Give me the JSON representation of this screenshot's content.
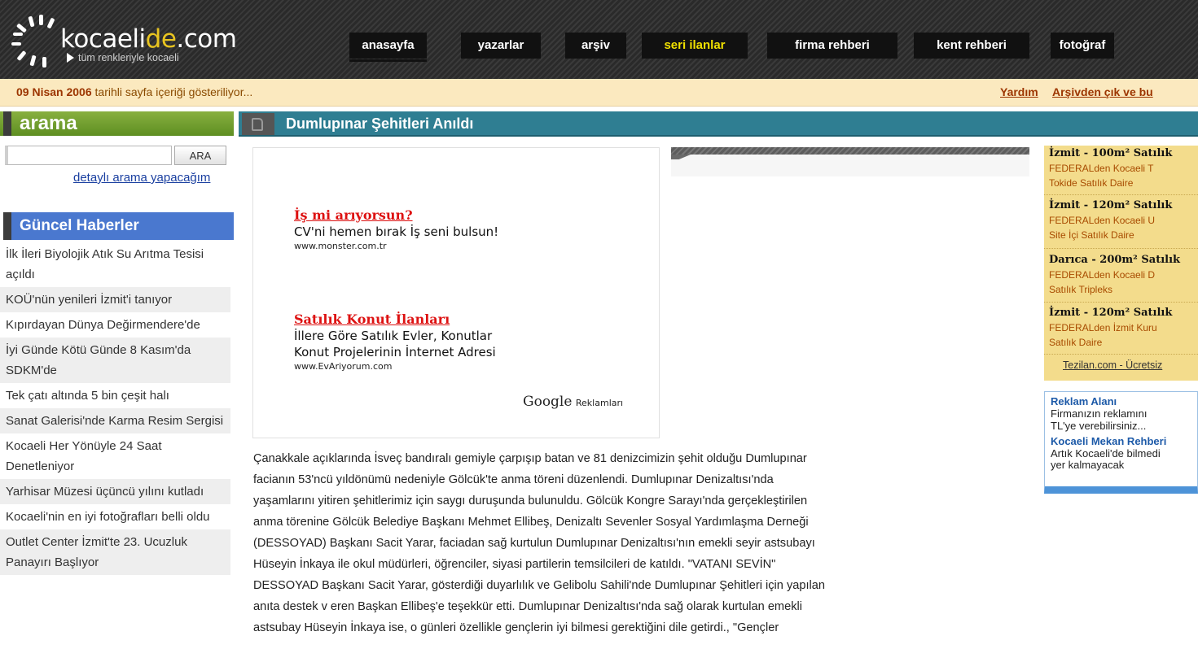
{
  "logo": {
    "brand_prefix": "kocaeli",
    "brand_accent": "de",
    "brand_suffix": ".com",
    "tagline": "tüm renkleriyle kocaeli"
  },
  "nav": {
    "items": [
      "anasayfa",
      "yazarlar",
      "arşiv",
      "seri ilanlar",
      "firma rehberi",
      "kent rehberi",
      "fotoğraf"
    ],
    "highlighted": "seri ilanlar"
  },
  "infobar": {
    "date": "09 Nisan 2006",
    "date_suffix": " tarihli sayfa içeriği gösteriliyor...",
    "help": "Yardım",
    "archive_exit": "Arşivden çık ve bu"
  },
  "sidebar": {
    "search_title": "arama",
    "search_input_value": "",
    "search_button": "ARA",
    "detailed_search": "detaylı arama yapacağım",
    "news_title": "Güncel Haberler",
    "news": [
      "İlk İleri Biyolojik Atık Su Arıtma Tesisi açıldı",
      "KOÜ'nün yenileri İzmit'i tanıyor",
      "Kıpırdayan Dünya Değirmendere'de",
      "İyi Günde Kötü Günde 8 Kasım'da SDKM'de",
      "Tek çatı altında 5 bin çeşit halı",
      "Sanat Galerisi'nde Karma Resim Sergisi",
      "Kocaeli Her Yönüyle 24 Saat Denetleniyor",
      "Yarhisar Müzesi üçüncü yılını kutladı",
      "Kocaeli'nin en iyi fotoğrafları belli oldu",
      "Outlet Center İzmit'te 23. Ucuzluk Panayırı Başlıyor"
    ]
  },
  "main": {
    "title": "Dumlupınar Şehitleri Anıldı",
    "ads": [
      {
        "title": "İş mi arıyorsun?",
        "lines": [
          "CV'ni hemen bırak İş seni bulsun!"
        ],
        "url": "www.monster.com.tr"
      },
      {
        "title": "Satılık Konut İlanları",
        "lines": [
          "İllere Göre Satılık Evler, Konutlar",
          "Konut Projelerinin İnternet Adresi"
        ],
        "url": "www.EvAriyorum.com"
      }
    ],
    "google_brand": "Google",
    "google_label": "Reklamları",
    "article_lines": [
      "Çanakkale açıklarında İsveç bandıralı gemiyle çarpışıp batan ve 81 denizcimizin şehit olduğu Dumlupınar",
      "facianın 53'ncü yıldönümü nedeniyle Gölcük'te anma töreni düzenlendi. Dumlupınar Denizaltısı'nda",
      "yaşamlarını yitiren şehitlerimiz için saygı duruşunda bulunuldu. Gölcük Kongre Sarayı'nda gerçekleştirilen",
      "anma törenine Gölcük Belediye Başkanı Mehmet Ellibeş, Denizaltı Sevenler Sosyal Yardımlaşma Derneği",
      "(DESSOYAD) Başkanı Sacit Yarar, faciadan sağ kurtulun Dumlupınar Denizaltısı'nın emekli seyir astsubayı",
      "Hüseyin İnkaya ile okul müdürleri, öğrenciler, siyasi partilerin temsilcileri de katıldı. \"VATANI SEVİN\"",
      "DESSOYAD Başkanı Sacit Yarar, gösterdiği duyarlılık ve Gelibolu Sahili'nde Dumlupınar Şehitleri için yapılan",
      "anıta destek v eren Başkan Ellibeş'e teşekkür etti. Dumlupınar Denizaltısı'nda sağ olarak kurtulan emekli",
      "astsubay Hüseyin İnkaya ise, o günleri özellikle gençlerin iyi bilmesi gerektiğini dile getirdi., \"Gençler"
    ]
  },
  "listings": {
    "items": [
      {
        "title": "İzmit - 100m² Satılık",
        "desc": [
          "FEDERALden Kocaeli T",
          "Tokide Satılık Daire"
        ]
      },
      {
        "title": "İzmit - 120m² Satılık",
        "desc": [
          "FEDERALden Kocaeli U",
          "Site İçi Satılık Daire"
        ]
      },
      {
        "title": "Darıca - 200m² Satılık",
        "desc": [
          "FEDERALden Kocaeli D",
          "Satılık Tripleks"
        ]
      },
      {
        "title": "İzmit - 120m² Satılık",
        "desc": [
          "FEDERALden İzmit Kuru",
          "Satılık Daire"
        ]
      }
    ],
    "footer_link": "Tezilan.com - Ücretsiz"
  },
  "ad_area": {
    "title": "Reklam Alanı",
    "text_lines": [
      "Firmanızın reklamını",
      "TL'ye verebilirsiniz..."
    ],
    "title2": "Kocaeli Mekan Rehberi",
    "text2_lines": [
      "Artık Kocaeli'de bilmedi",
      "yer kalmayacak"
    ]
  },
  "colors": {
    "header_bg": "#2e2e2e",
    "infobar_bg": "#fbe9bf",
    "search_head": "#6e9c2c",
    "news_head": "#4a78cf",
    "title_bar": "#2f7e92",
    "listings_bg": "#f3dc8c",
    "ad_title": "#d11111",
    "link_blue": "#1a3fa0"
  }
}
